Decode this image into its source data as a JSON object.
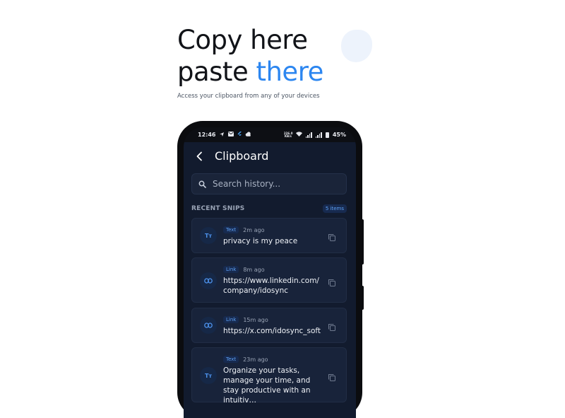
{
  "hero": {
    "title_line1": "Copy here",
    "title_line2_start": "paste ",
    "title_line2_accent": "there",
    "subtitle": "Access your clipboard from any of your devices"
  },
  "status_bar": {
    "time": "12:46",
    "network": "226.0 KB/s",
    "battery": "45%"
  },
  "app": {
    "title": "Clipboard",
    "back_icon": "chevron-left-icon",
    "search_placeholder": "Search history...",
    "section_label": "RECENT SNIPS",
    "item_count": "5 items"
  },
  "snips": [
    {
      "type": "Text",
      "icon": "text-type-icon",
      "icon_glyph": "Tт",
      "time": "2m ago",
      "content": "privacy is my peace"
    },
    {
      "type": "Link",
      "icon": "link-icon",
      "icon_glyph": "",
      "time": "8m ago",
      "content": "https://www.linkedin.com/ company/idosync"
    },
    {
      "type": "Link",
      "icon": "link-icon",
      "icon_glyph": "",
      "time": "15m ago",
      "content": "https://x.com/idosync_soft"
    },
    {
      "type": "Text",
      "icon": "text-type-icon",
      "icon_glyph": "Tт",
      "time": "23m ago",
      "content": "Organize your tasks, manage your time, and stay productive with an intuitiv…"
    }
  ],
  "colors": {
    "accent": "#2c86f0",
    "screen_bg": "#121b2e",
    "card_bg": "#18233a"
  }
}
